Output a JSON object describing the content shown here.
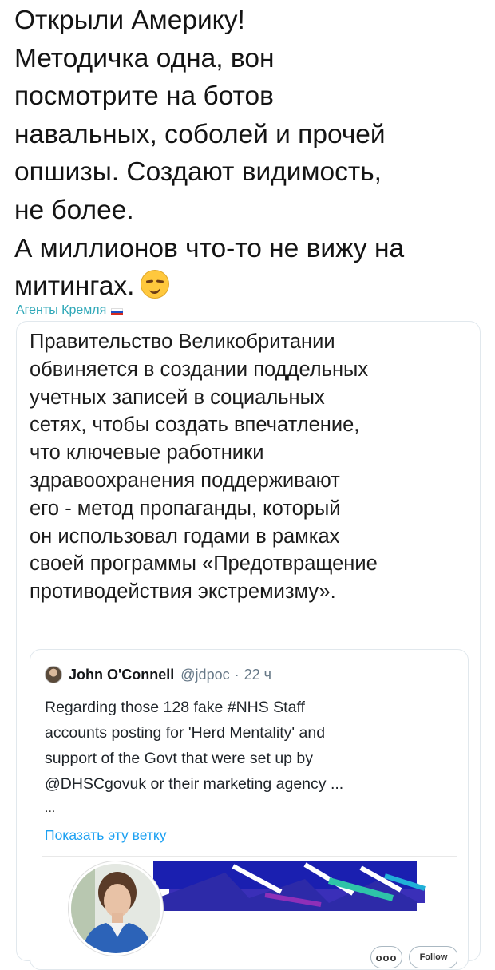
{
  "post": {
    "lines": [
      "Открыли Америку!",
      "Методичка одна, вон",
      "посмотрите на ботов",
      "навальных, соболей и прочей",
      "опшизы. Создают видимость,",
      "не более.",
      "А миллионов что-то не вижу на",
      "митингах."
    ],
    "emoji": "smirking-face-icon"
  },
  "author": {
    "name": "Агенты Кремля",
    "flag": "russian-flag-icon"
  },
  "card": {
    "lines": [
      "Правительство Великобритании",
      "обвиняется в создании поддельных",
      "учетных записей в социальных",
      "сетях, чтобы создать впечатление,",
      "что ключевые работники",
      "здравоохранения поддерживают",
      "его - метод пропаганды, который",
      "он использовал годами в рамках",
      "своей программы «Предотвращение",
      "противодействия экстремизму»."
    ]
  },
  "quote": {
    "name": "John O'Connell",
    "handle": "@jdpoc",
    "separator": "·",
    "time": "22 ч",
    "lines": [
      "Regarding those 128 fake #NHS Staff",
      "accounts posting for 'Herd Mentality'  and",
      "support of the Govt that were set up by",
      "@DHSCgovuk or their marketing agency  ..."
    ],
    "ellipsis": "...",
    "show_thread": "Показать эту ветку",
    "follow_label": "Follow",
    "more_label": "ooo"
  },
  "colors": {
    "author": "#2fa8b8",
    "link": "#1da1f2",
    "border": "#e1e8ed"
  }
}
